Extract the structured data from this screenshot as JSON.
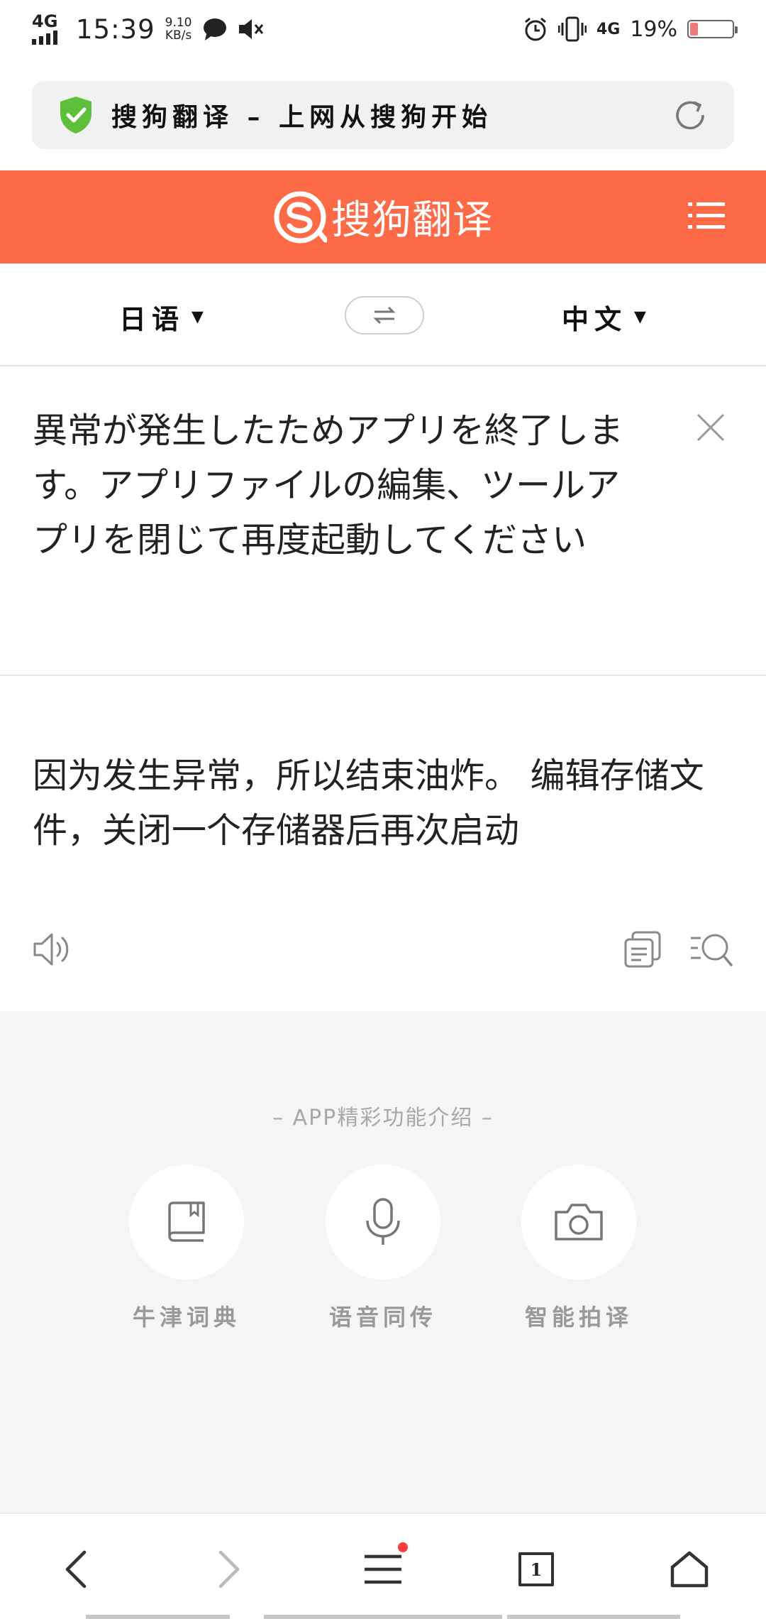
{
  "status_bar": {
    "network": "4G",
    "time": "15:39",
    "speed_value": "9.10",
    "speed_unit": "KB/s",
    "network_right": "4G",
    "battery": "19%",
    "battery_level": 0.19
  },
  "address_bar": {
    "title": "搜狗翻译 – 上网从搜狗开始"
  },
  "header": {
    "logo_text": "搜狗翻译",
    "accent_color": "#fd6a47"
  },
  "language_bar": {
    "source_lang": "日语",
    "target_lang": "中文"
  },
  "source": {
    "text": "異常が発生したためアプリを終了します。アプリファイルの編集、ツールアプリを閉じて再度起動してください"
  },
  "result": {
    "text": "因为发生异常，所以结束油炸。  编辑存储文件，关闭一个存储器后再次启动"
  },
  "features": {
    "title": "– APP精彩功能介绍 –",
    "items": [
      {
        "label": "牛津词典",
        "icon": "book-icon"
      },
      {
        "label": "语音同传",
        "icon": "microphone-icon"
      },
      {
        "label": "智能拍译",
        "icon": "camera-icon"
      }
    ]
  },
  "bottom_nav": {
    "tab_count": "1"
  }
}
